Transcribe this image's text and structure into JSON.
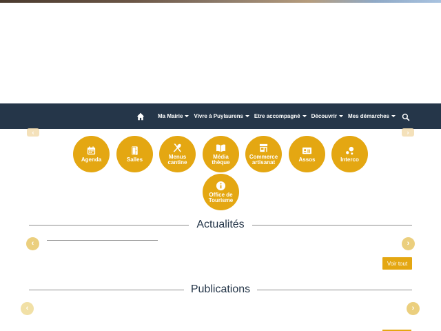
{
  "navbar": {
    "items": [
      {
        "label": "Ma Mairie"
      },
      {
        "label": "Vivre à Puylaurens"
      },
      {
        "label": "Etre accompagné"
      },
      {
        "label": "Découvrir"
      },
      {
        "label": "Mes démarches"
      }
    ]
  },
  "quick_links": [
    {
      "label": "Agenda"
    },
    {
      "label": "Salles"
    },
    {
      "label": "Menus\ncantine"
    },
    {
      "label": "Média\nthèque"
    },
    {
      "label": "Commerce\nartisanat"
    },
    {
      "label": "Assos"
    },
    {
      "label": "Interco"
    },
    {
      "label": "Office de\nTourisme"
    }
  ],
  "actualites": {
    "title": "Actualités",
    "button": "Voir tout"
  },
  "publications": {
    "title": "Publications"
  },
  "colors": {
    "navbar": "#253649",
    "accent": "#e4a712",
    "arrow": "#ebcf7e"
  }
}
